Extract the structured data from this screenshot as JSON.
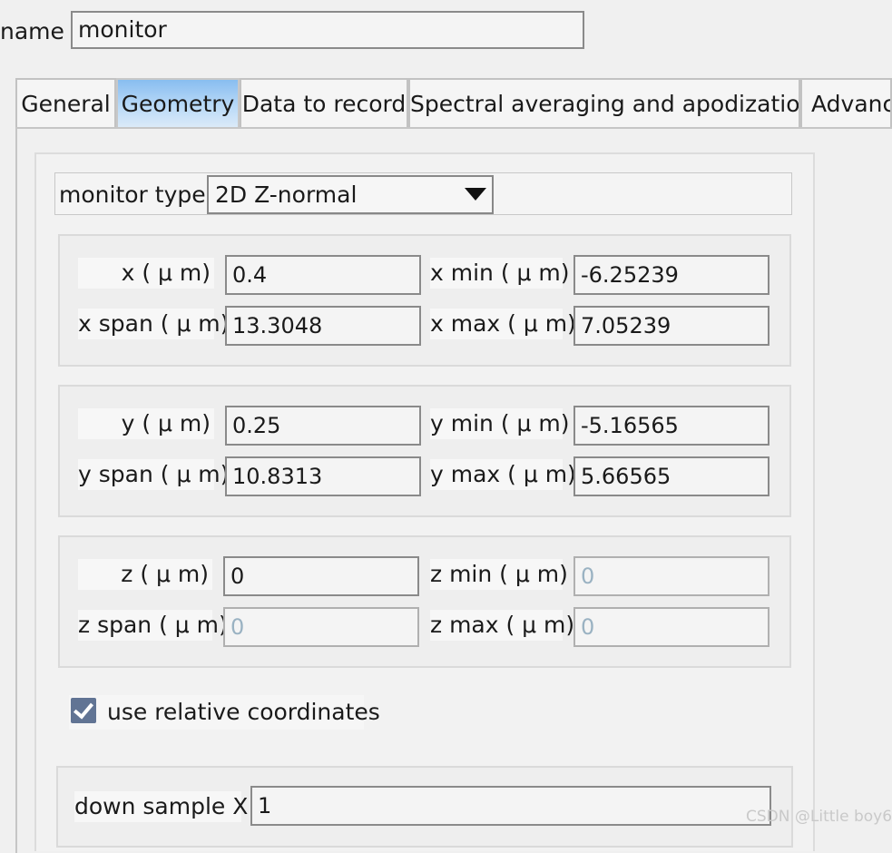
{
  "name": {
    "label": "name",
    "value": "monitor"
  },
  "tabs": [
    {
      "label": "General",
      "active": false
    },
    {
      "label": "Geometry",
      "active": true
    },
    {
      "label": "Data to record",
      "active": false
    },
    {
      "label": "Spectral averaging and apodization",
      "active": false
    },
    {
      "label": "Advance",
      "active": false
    }
  ],
  "monitor_type": {
    "label": "monitor type",
    "value": "2D Z-normal"
  },
  "x_group": {
    "center_label": "x ( μ m)",
    "center_value": "0.4",
    "span_label": "x span ( μ m)",
    "span_value": "13.3048",
    "min_label": "x min ( μ m)",
    "min_value": "-6.25239",
    "max_label": "x max ( μ m)",
    "max_value": "7.05239"
  },
  "y_group": {
    "center_label": "y ( μ m)",
    "center_value": "0.25",
    "span_label": "y span ( μ m)",
    "span_value": "10.8313",
    "min_label": "y min ( μ m)",
    "min_value": "-5.16565",
    "max_label": "y max ( μ m)",
    "max_value": "5.66565"
  },
  "z_group": {
    "center_label": "z ( μ m)",
    "center_value": "0",
    "span_label": "z span ( μ m)",
    "span_value": "0",
    "min_label": "z min ( μ m)",
    "min_value": "0",
    "max_label": "z max ( μ m)",
    "max_value": "0"
  },
  "relative_coords": {
    "label": "use relative coordinates",
    "checked": true
  },
  "down_sample": {
    "label": "down sample X",
    "value": "1"
  },
  "watermark": "CSDN @Little boy6"
}
